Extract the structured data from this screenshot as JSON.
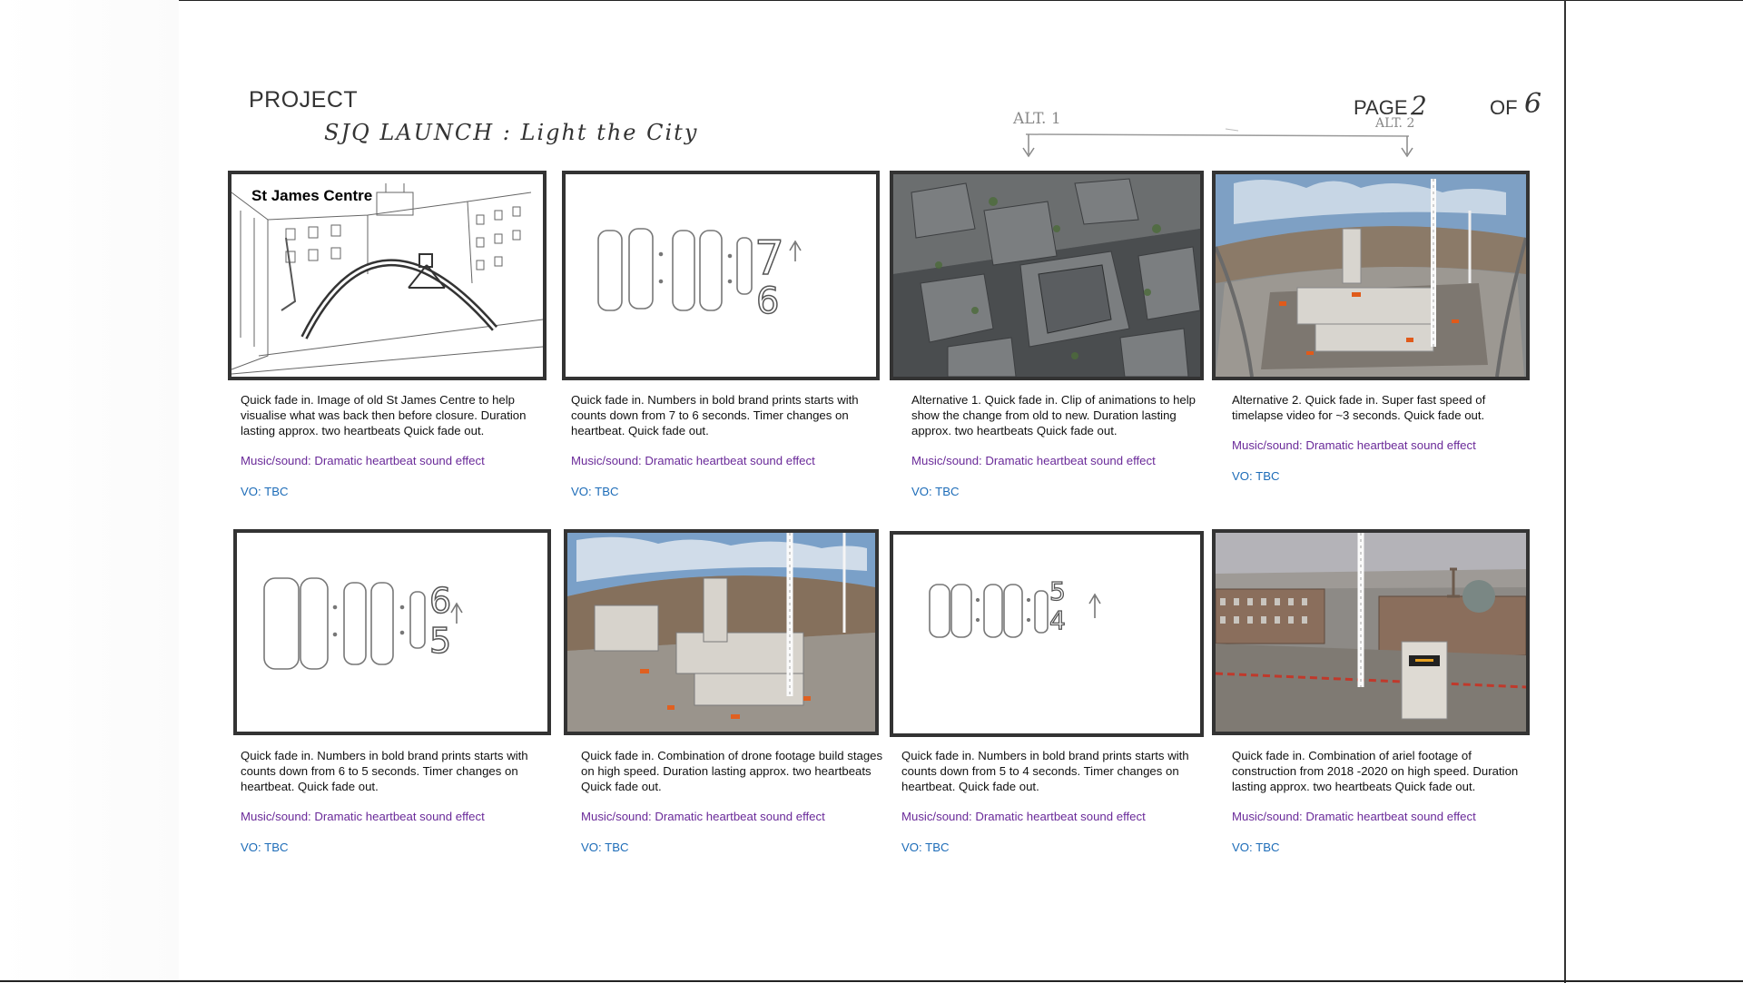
{
  "header": {
    "project_label": "PROJECT",
    "project_title": "SJQ LAUNCH : Light the City",
    "page_label": "PAGE",
    "page_number": "2",
    "of_label": "OF",
    "total_pages": "6",
    "alt1_label": "ALT. 1",
    "alt2_label": "ALT. 2"
  },
  "panels": [
    {
      "image": "sketch of old St James Centre with arch",
      "image_title": "St James Centre",
      "description": "Quick fade in. Image of old St James Centre to help visualise what was back then before closure. Duration lasting approx. two heartbeats  Quick fade out.",
      "music": "Music/sound: Dramatic heartbeat sound effect",
      "vo": "VO: TBC"
    },
    {
      "image": "sketch of countdown timer 00:00:07 to 06",
      "description": "Quick fade in. Numbers in bold brand prints starts with counts down from 7 to 6 seconds. Timer changes on heartbeat. Quick fade out.",
      "music": "Music/sound: Dramatic heartbeat sound effect",
      "vo": "VO: TBC"
    },
    {
      "image": "aerial city render",
      "description": "Alternative 1. Quick fade in. Clip of animations to help show the change from old to new. Duration lasting approx. two heartbeats  Quick fade out.",
      "music": "Music/sound: Dramatic heartbeat sound effect",
      "vo": "VO: TBC"
    },
    {
      "image": "fisheye construction timelapse",
      "description": "Alternative 2. Quick fade in. Super fast speed of timelapse video for ~3 seconds. Quick fade out.",
      "music": "Music/sound: Dramatic heartbeat sound effect",
      "vo": "VO: TBC"
    },
    {
      "image": "sketch of countdown timer 00:00:06 to 05",
      "description": "Quick fade in. Numbers in bold brand prints starts with counts down from 6 to 5 seconds. Timer changes on heartbeat. Quick fade out.",
      "music": "Music/sound: Dramatic heartbeat sound effect",
      "vo": "VO: TBC"
    },
    {
      "image": "drone footage of construction site",
      "description": "Quick fade in. Combination of drone footage build stages on high speed. Duration lasting approx. two heartbeats  Quick fade out.",
      "music": "Music/sound: Dramatic heartbeat sound effect",
      "vo": "VO: TBC"
    },
    {
      "image": "sketch of countdown timer 00:00:05 to 04",
      "description": "Quick fade in. Numbers in bold brand prints starts with counts down from 5 to 4 seconds. Timer changes on heartbeat. Quick fade out.",
      "music": "Music/sound: Dramatic heartbeat sound effect",
      "vo": "VO: TBC"
    },
    {
      "image": "aerial footage of construction with crane",
      "description": "Quick fade in. Combination of ariel footage of construction from 2018 -2020 on high speed. Duration lasting approx. two heartbeats  Quick fade out.",
      "music": "Music/sound: Dramatic heartbeat sound effect",
      "vo": "VO: TBC"
    }
  ],
  "timer_digits": {
    "p2": {
      "main": "7",
      "next": "6"
    },
    "p5": {
      "main": "6",
      "next": "5"
    },
    "p7": {
      "main": "5",
      "next": "4"
    }
  }
}
